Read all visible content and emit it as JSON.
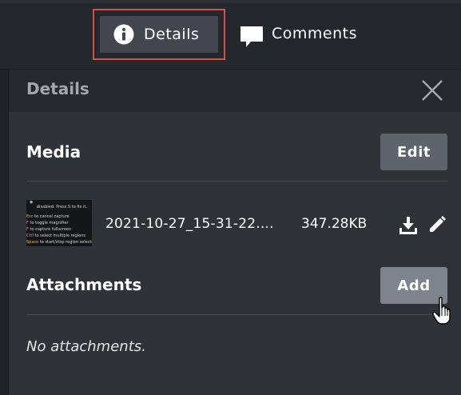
{
  "tabs": {
    "details_label": "Details",
    "comments_label": "Comments"
  },
  "panel": {
    "title": "Details"
  },
  "media": {
    "title": "Media",
    "edit_label": "Edit",
    "file_name": "2021-10-27_15-31-22....",
    "file_size": "347.28KB",
    "thumbnail_lines": [
      "disabled. Press S to fix it.",
      "Esc  to cancel capture",
      "F  to toggle magnifier",
      "F  to capture fullscreen",
      "Ctrl  to select multiple regions",
      "Space  to start/stop region selection"
    ]
  },
  "attachments": {
    "title": "Attachments",
    "add_label": "Add",
    "empty_text": "No attachments."
  },
  "icons": {
    "info": "info-icon",
    "comment": "comment-icon",
    "close": "close-icon",
    "download": "download-icon",
    "edit": "pencil-icon",
    "cursor": "hand-cursor-icon"
  },
  "colors": {
    "highlight_border": "#d2514d",
    "button_bg": "#5f646c",
    "button_hover_bg": "#7f848b",
    "panel_bg": "#2f3237"
  }
}
